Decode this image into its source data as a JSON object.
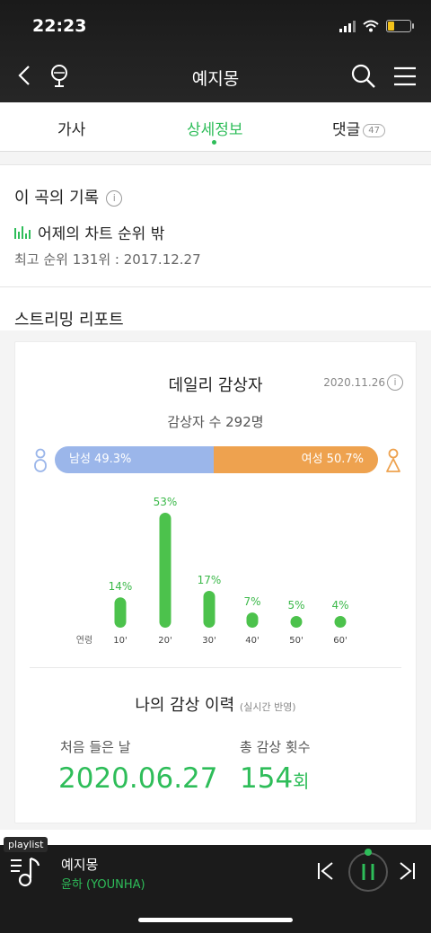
{
  "status": {
    "time": "22:23"
  },
  "nav": {
    "title": "예지몽"
  },
  "tabs": {
    "lyrics": "가사",
    "detail": "상세정보",
    "comments": "댓글",
    "comments_count": "47"
  },
  "record": {
    "title": "이 곡의 기록",
    "chart_status": "어제의 차트 순위 밖",
    "best_rank": "최고 순위 131위 : 2017.12.27"
  },
  "streaming": {
    "title": "스트리밍 리포트",
    "daily_title": "데일리 감상자",
    "date": "2020.11.26",
    "listener_count": "감상자 수 292명",
    "male_label": "남성 49.3%",
    "female_label": "여성 50.7%",
    "male_pct": 49.3,
    "female_pct": 50.7,
    "age_axis_label": "연령"
  },
  "chart_data": {
    "type": "bar",
    "categories": [
      "10'",
      "20'",
      "30'",
      "40'",
      "50'",
      "60'"
    ],
    "values": [
      14,
      53,
      17,
      7,
      5,
      4
    ],
    "value_labels": [
      "14%",
      "53%",
      "17%",
      "7%",
      "5%",
      "4%"
    ],
    "xlabel": "연령",
    "color": "#4cc24c"
  },
  "my_history": {
    "title": "나의 감상 이력",
    "subtitle": "(실시간 반영)",
    "first_listen_label": "처음 들은 날",
    "first_listen_date": "2020.06.27",
    "total_label": "총 감상 횟수",
    "total_count": "154",
    "total_unit": "회"
  },
  "player": {
    "badge": "playlist",
    "title": "예지몽",
    "artist": "윤하 (YOUNHA)"
  },
  "colors": {
    "accent": "#2ebd59",
    "male": "#9bb6ea",
    "female": "#eea24f"
  }
}
